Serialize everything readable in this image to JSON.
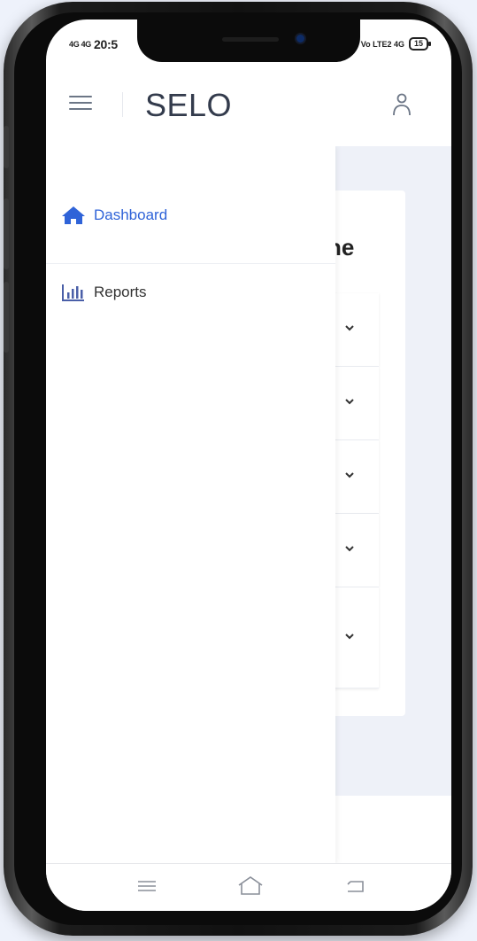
{
  "status_bar": {
    "left_signal": "4G 4G",
    "time": "20:5",
    "right_network": "Vo LTE2 4G",
    "battery": "15"
  },
  "header": {
    "title": "SELO",
    "menu_icon": "hamburger-icon",
    "profile_icon": "user-icon"
  },
  "drawer": {
    "items": [
      {
        "label": "Dashboard",
        "icon": "home-icon",
        "active": true
      },
      {
        "label": "Reports",
        "icon": "bar-chart-icon",
        "active": false
      }
    ]
  },
  "main": {
    "card_title_fragment": "ne",
    "accordion_rows": 5
  },
  "navbar": {
    "icons": [
      "recent-apps-icon",
      "home-outline-icon",
      "back-icon"
    ]
  },
  "colors": {
    "accent": "#2f63d8",
    "background": "#eef2fb"
  }
}
